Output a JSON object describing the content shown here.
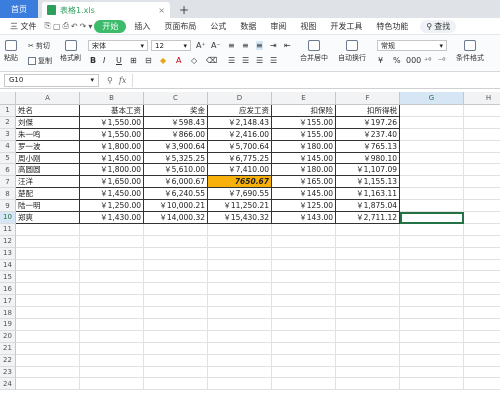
{
  "titlebar": {
    "home": "首页",
    "doc_title": "表格1.xls",
    "close": "×",
    "new_tab": "+"
  },
  "menu": {
    "file": "三 文件",
    "icons": [
      "⎘",
      "▢",
      "⎙",
      "↶",
      "↷",
      "▾"
    ],
    "start": "开始",
    "items": [
      "插入",
      "页面布局",
      "公式",
      "数据",
      "审阅",
      "视图",
      "开发工具",
      "特色功能"
    ],
    "search": "查找"
  },
  "toolbar": {
    "paste": "粘贴",
    "cut": "剪切",
    "copy": "复制",
    "format_painter": "格式刷",
    "font": "宋体",
    "font_size": "12",
    "bold": "B",
    "italic": "I",
    "underline": "U",
    "merge_center": "合并居中",
    "wrap_text": "自动换行",
    "number_format": "常规",
    "currency": "¥",
    "percent": "%",
    "thousands": "000",
    "conditional_format": "条件格式"
  },
  "formula_bar": {
    "name_box": "G10",
    "fx": "fx",
    "value": ""
  },
  "columns": [
    "A",
    "B",
    "C",
    "D",
    "E",
    "F",
    "G",
    "H"
  ],
  "selected_column": "G",
  "selected_row": 10,
  "row_numbers": [
    "1",
    "2",
    "3",
    "4",
    "5",
    "6",
    "7",
    "8",
    "9",
    "10",
    "11",
    "12",
    "13",
    "14",
    "15",
    "16",
    "17",
    "18",
    "19",
    "20",
    "21",
    "22",
    "23",
    "24"
  ],
  "table": {
    "headers": [
      "姓名",
      "基本工资",
      "奖金",
      "应发工资",
      "扣保险",
      "扣所得税"
    ],
    "rows": [
      [
        "刘傑",
        "￥1,550.00",
        "￥598.43",
        "￥2,148.43",
        "￥155.00",
        "￥197.26"
      ],
      [
        "朱一鸣",
        "￥1,550.00",
        "￥866.00",
        "￥2,416.00",
        "￥155.00",
        "￥237.40"
      ],
      [
        "罗一波",
        "￥1,800.00",
        "￥3,900.64",
        "￥5,700.64",
        "￥180.00",
        "￥765.13"
      ],
      [
        "周小刚",
        "￥1,450.00",
        "￥5,325.25",
        "￥6,775.25",
        "￥145.00",
        "￥980.10"
      ],
      [
        "高圆圆",
        "￥1,800.00",
        "￥5,610.00",
        "￥7,410.00",
        "￥180.00",
        "￥1,107.09"
      ],
      [
        "汪洋",
        "￥1,650.00",
        "￥6,000.67",
        "7650.67",
        "￥165.00",
        "￥1,155.13"
      ],
      [
        "楚配",
        "￥1,450.00",
        "￥6,240.55",
        "￥7,690.55",
        "￥145.00",
        "￥1,163.11"
      ],
      [
        "陆一明",
        "￥1,250.00",
        "￥10,000.21",
        "￥11,250.21",
        "￥125.00",
        "￥1,875.04"
      ],
      [
        "郑爽",
        "￥1,430.00",
        "￥14,000.32",
        "￥15,430.32",
        "￥143.00",
        "￥2,711.12"
      ]
    ]
  },
  "highlight_color": "#f8b10b",
  "accent_green": "#3dbb6b",
  "brand_blue": "#3b7ddd"
}
